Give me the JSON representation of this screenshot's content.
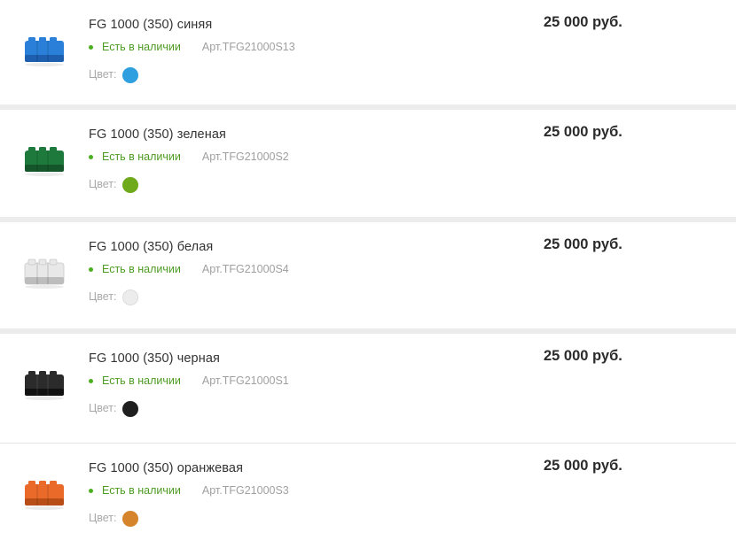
{
  "products": [
    {
      "name": "FG 1000 (350) синяя",
      "stock": "Есть в наличии",
      "article": "Арт.TFG21000S13",
      "color_label": "Цвет:",
      "swatch": "#2f9fe0",
      "tank_color": "#2a7fd9",
      "tank_shade": "#1d5fae",
      "price": "25 000 руб."
    },
    {
      "name": "FG 1000 (350) зеленая",
      "stock": "Есть в наличии",
      "article": "Арт.TFG21000S2",
      "color_label": "Цвет:",
      "swatch": "#6fa91c",
      "tank_color": "#1e7a3c",
      "tank_shade": "#14552a",
      "price": "25 000 руб."
    },
    {
      "name": "FG 1000 (350) белая",
      "stock": "Есть в наличии",
      "article": "Арт.TFG21000S4",
      "color_label": "Цвет:",
      "swatch": "#ececec",
      "tank_color": "#e8e8e8",
      "tank_shade": "#bdbdbd",
      "price": "25 000 руб."
    },
    {
      "name": "FG 1000 (350) черная",
      "stock": "Есть в наличии",
      "article": "Арт.TFG21000S1",
      "color_label": "Цвет:",
      "swatch": "#1f1f1f",
      "tank_color": "#2b2b2b",
      "tank_shade": "#111111",
      "price": "25 000 руб."
    },
    {
      "name": "FG 1000 (350) оранжевая",
      "stock": "Есть в наличии",
      "article": "Арт.TFG21000S3",
      "color_label": "Цвет:",
      "swatch": "#d5842c",
      "tank_color": "#ea6a2a",
      "tank_shade": "#b94d18",
      "price": "25 000 руб."
    }
  ]
}
